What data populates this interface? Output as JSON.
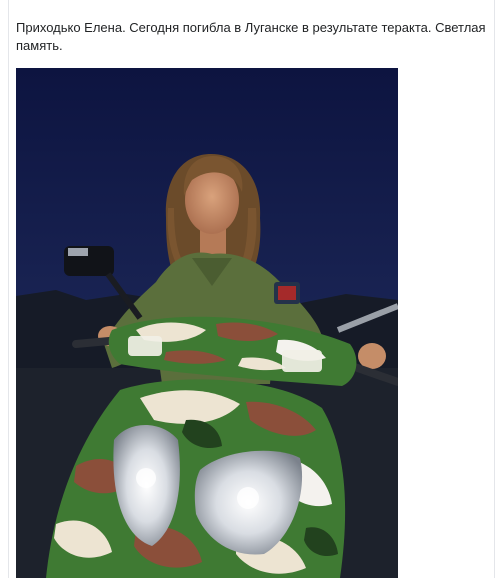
{
  "post": {
    "text": "Приходько Елена. Сегодня погибла в Луганске в результате теракта. Светлая память."
  },
  "photo": {
    "subject": "woman-on-camouflage-scooter",
    "colors": {
      "sky_top": "#0d1440",
      "sky_bottom": "#26335f",
      "ground": "#1a1f2a",
      "uniform": "#5b6f3c",
      "camo_green": "#3f7a33",
      "camo_brown": "#8b4f3a",
      "camo_cream": "#ede4d2",
      "camo_white": "#f4f2ee"
    }
  }
}
